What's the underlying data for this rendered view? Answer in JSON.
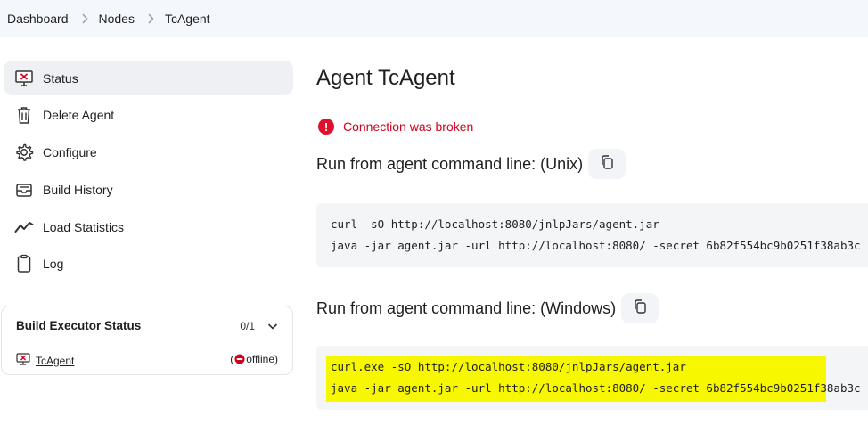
{
  "breadcrumb": {
    "items": [
      "Dashboard",
      "Nodes",
      "TcAgent"
    ]
  },
  "sidebar": {
    "items": [
      {
        "label": "Status",
        "icon": "computer-offline-icon"
      },
      {
        "label": "Delete Agent",
        "icon": "trash-icon"
      },
      {
        "label": "Configure",
        "icon": "gear-icon"
      },
      {
        "label": "Build History",
        "icon": "inbox-icon"
      },
      {
        "label": "Load Statistics",
        "icon": "trend-icon"
      },
      {
        "label": "Log",
        "icon": "clipboard-icon"
      }
    ]
  },
  "executor": {
    "title": "Build Executor Status",
    "count": "0/1",
    "agent": "TcAgent",
    "status_open": "(",
    "status_text": " offline)"
  },
  "main": {
    "title": "Agent TcAgent",
    "error": "Connection was broken",
    "unix_heading": "Run from agent command line: (Unix)",
    "unix_lines": [
      "curl -sO http://localhost:8080/jnlpJars/agent.jar",
      "java -jar agent.jar -url http://localhost:8080/ -secret 6b82f554bc9b0251f38ab3c"
    ],
    "windows_heading": "Run from agent command line: (Windows)",
    "windows_lines": [
      "curl.exe -sO http://localhost:8080/jnlpJars/agent.jar",
      "java -jar agent.jar -url http://localhost:8080/ -secret 6b82f554bc9b0251f38ab3c"
    ]
  },
  "colors": {
    "error": "#d0021b",
    "highlight": "#f7f700",
    "breadcrumb_bg": "#f4f7fb",
    "active_bg": "#eef0f3"
  }
}
